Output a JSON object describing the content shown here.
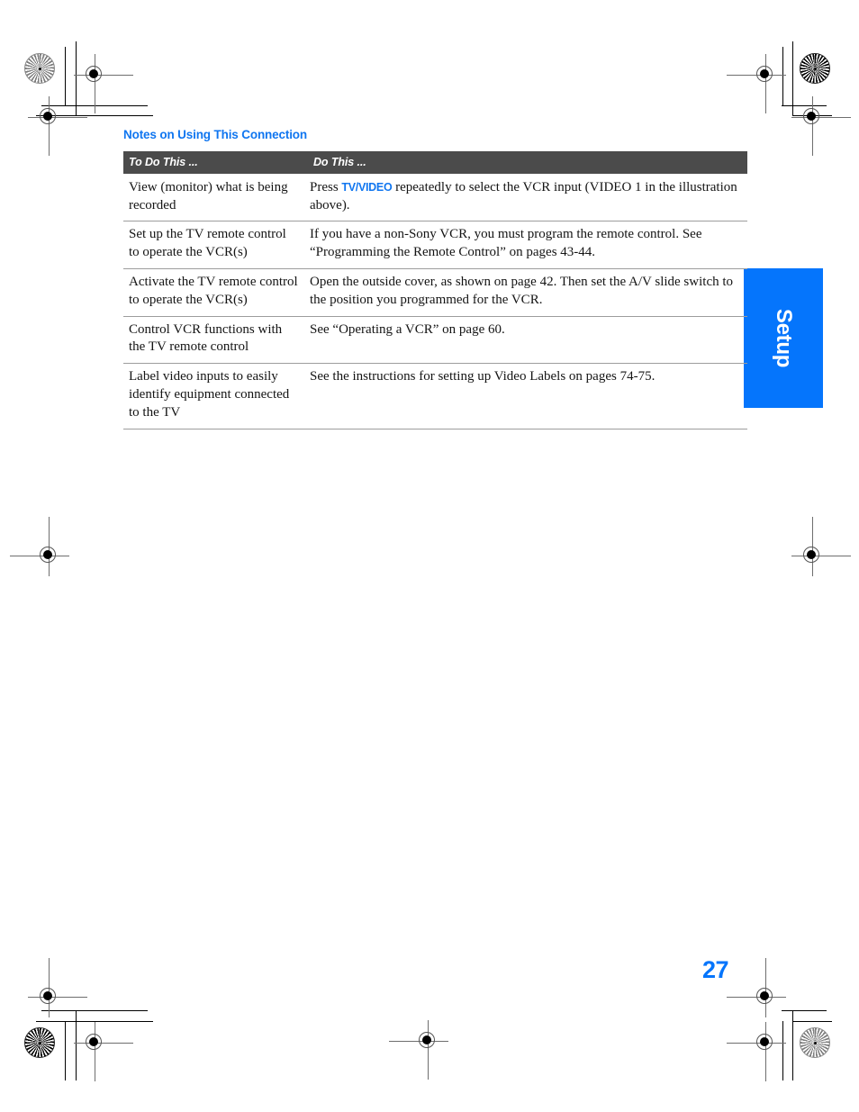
{
  "page": {
    "number": "27",
    "side_tab_label": "Setup",
    "heading": "Notes on Using This Connection",
    "accent_color": "#0575fc",
    "heading_color": "#1076f0",
    "table_header_bg": "#4b4b4b"
  },
  "table": {
    "columns": [
      "To Do This ...",
      "Do This ..."
    ],
    "rows": [
      {
        "todo": "View (monitor) what is being recorded",
        "do_pre": "Press ",
        "do_kw": "TV/VIDEO",
        "do_post": " repeatedly to select the VCR input (VIDEO 1 in the illustration above)."
      },
      {
        "todo": "Set up the TV remote control to operate the VCR(s)",
        "do": "If you have a non-Sony VCR, you must program the remote control. See “Programming the Remote Control” on pages 43-44."
      },
      {
        "todo": "Activate the TV remote control to operate the VCR(s)",
        "do": "Open the outside cover, as shown on page 42. Then set the A/V slide switch to the position you programmed for the VCR."
      },
      {
        "todo": "Control VCR functions with the TV remote control",
        "do": "See “Operating a VCR” on page 60."
      },
      {
        "todo": "Label video inputs to easily identify equipment connected to the TV",
        "do": "See the instructions for setting up Video Labels on pages 74-75."
      }
    ]
  }
}
